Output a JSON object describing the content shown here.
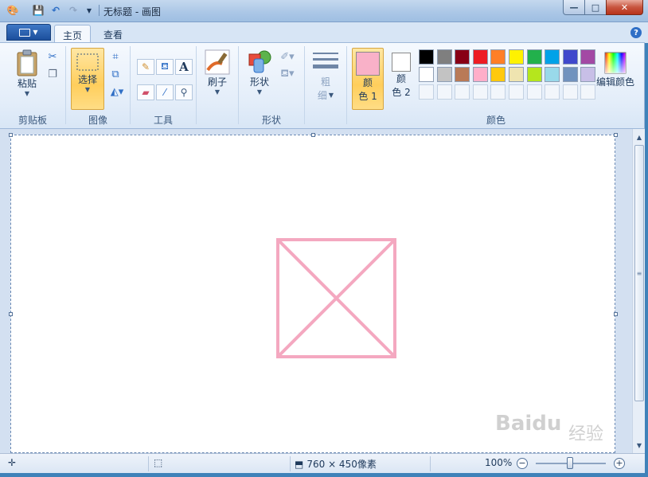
{
  "window": {
    "title": "无标题 - 画图",
    "minimize": "—",
    "maximize": "□",
    "close": "✕"
  },
  "tabs": [
    {
      "label": "主页"
    },
    {
      "label": "查看"
    }
  ],
  "help_label": "?",
  "ribbon": {
    "clipboard": {
      "label": "剪贴板",
      "paste": "粘贴"
    },
    "image": {
      "label": "图像",
      "select": "选择"
    },
    "tools": {
      "label": "工具",
      "text_tool": "A"
    },
    "brushes": {
      "label": "刷子"
    },
    "shapes": {
      "label": "形状",
      "shapes_btn": "形状"
    },
    "size": {
      "label_line1": "粗",
      "label_line2": "细"
    },
    "colors": {
      "label": "颜色",
      "color1_line1": "颜",
      "color1_line2": "色 1",
      "color2_line1": "颜",
      "color2_line2": "色 2",
      "edit_colors": "编辑颜色",
      "color1_value": "#f9b1c8",
      "color2_value": "#ffffff",
      "palette_row1": [
        "#000000",
        "#7f7f7f",
        "#880015",
        "#ed1c24",
        "#ff7f27",
        "#fff200",
        "#22b14c",
        "#00a2e8",
        "#3f48cc",
        "#a349a4"
      ],
      "palette_row2": [
        "#ffffff",
        "#c3c3c3",
        "#b97a57",
        "#ffaec9",
        "#ffc90e",
        "#efe4b0",
        "#b5e61d",
        "#99d9ea",
        "#7092be",
        "#c8bfe7"
      ]
    }
  },
  "canvas": {
    "stroke_color": "#f4a8c0"
  },
  "statusbar": {
    "dimensions": "760 × 450像素",
    "zoom": "100%"
  },
  "watermark": {
    "brand": "Baidu",
    "suffix": "经验"
  }
}
